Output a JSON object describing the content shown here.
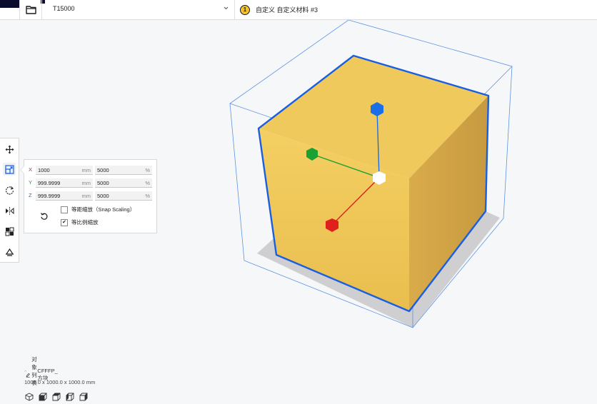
{
  "header": {
    "printer_name": "T15000",
    "material_index": "1",
    "material_name": "自定义 自定义材料 #3"
  },
  "scale_panel": {
    "x": {
      "axis": "X",
      "size": "1000",
      "size_unit": "mm",
      "percent": "5000",
      "percent_unit": "%"
    },
    "y": {
      "axis": "Y",
      "size": "999.9999",
      "size_unit": "mm",
      "percent": "5000",
      "percent_unit": "%"
    },
    "z": {
      "axis": "Z",
      "size": "999.9999",
      "size_unit": "mm",
      "percent": "5000",
      "percent_unit": "%"
    },
    "snap_scaling_label": "等距缩放（Snap Scaling）",
    "snap_scaling_checked": false,
    "uniform_scaling_label": "等比例缩放",
    "uniform_scaling_checked": true,
    "check_mark": "✔"
  },
  "object_list": {
    "title": "对象列表",
    "object_name": "CFFFP_方块",
    "dimensions": "1000.0 x 1000.0 x 1000.0 mm"
  },
  "toolbar": {
    "tools": [
      "move-icon",
      "scale-icon",
      "rotate-icon",
      "mirror-icon",
      "per-model-settings-icon",
      "support-blocker-icon"
    ],
    "active_tool": "scale-icon"
  },
  "colors": {
    "accent": "#1a5fe0",
    "model": "#f0c95c",
    "axis_x": "#e0201c",
    "axis_y": "#1aa033",
    "axis_z": "#1a6fe6",
    "material_badge": "#f2c230"
  }
}
